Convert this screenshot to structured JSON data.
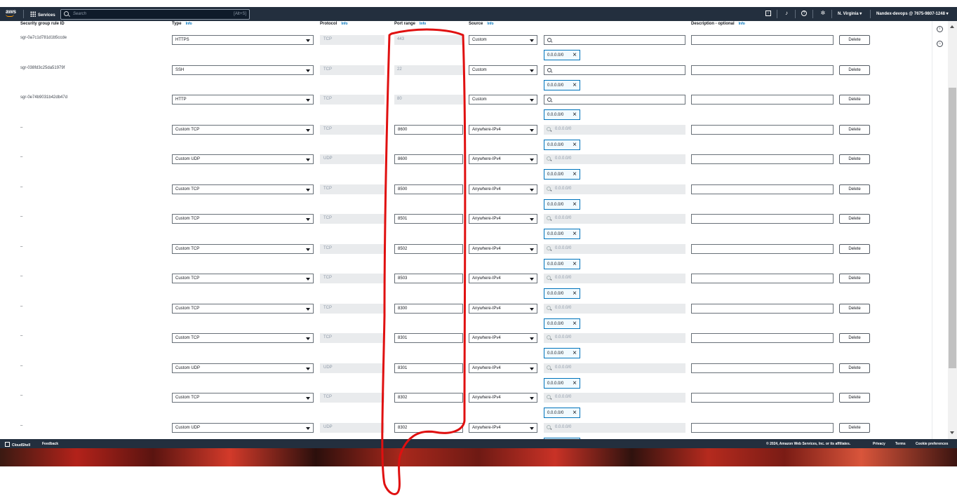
{
  "topbar": {
    "logo": "aws",
    "services": "Services",
    "search_placeholder": "Search",
    "shortcut": "[Alt+S]",
    "region": "N. Virginia",
    "account": "Nandex-devops @ 7675-9807-1248"
  },
  "columns": {
    "rule_id": "Security group rule ID",
    "type": "Type",
    "protocol": "Protocol",
    "port_range": "Port range",
    "source": "Source",
    "description": "Description - optional",
    "info": "Info"
  },
  "rows": [
    {
      "id": "sgr-0a7c1d781d1b5ccde",
      "type": "HTTPS",
      "protocol": "TCP",
      "port": "443",
      "source": "Custom",
      "cidr_search": "",
      "token": "0.0.0.0/0"
    },
    {
      "id": "sgr-038fd3c25da51979f",
      "type": "SSH",
      "protocol": "TCP",
      "port": "22",
      "source": "Custom",
      "cidr_search": "",
      "token": "0.0.0.0/0"
    },
    {
      "id": "sgr-0e74b9031b42db47d",
      "type": "HTTP",
      "protocol": "TCP",
      "port": "80",
      "source": "Custom",
      "cidr_search": "",
      "token": "0.0.0.0/0"
    },
    {
      "id": "–",
      "type": "Custom TCP",
      "protocol": "TCP",
      "port": "8600",
      "source": "Anywhere-IPv4",
      "cidr_search": "0.0.0.0/0",
      "token": "0.0.0.0/0"
    },
    {
      "id": "–",
      "type": "Custom UDP",
      "protocol": "UDP",
      "port": "8600",
      "source": "Anywhere-IPv4",
      "cidr_search": "0.0.0.0/0",
      "token": "0.0.0.0/0"
    },
    {
      "id": "–",
      "type": "Custom TCP",
      "protocol": "TCP",
      "port": "8500",
      "source": "Anywhere-IPv4",
      "cidr_search": "0.0.0.0/0",
      "token": "0.0.0.0/0"
    },
    {
      "id": "–",
      "type": "Custom TCP",
      "protocol": "TCP",
      "port": "8501",
      "source": "Anywhere-IPv4",
      "cidr_search": "0.0.0.0/0",
      "token": "0.0.0.0/0"
    },
    {
      "id": "–",
      "type": "Custom TCP",
      "protocol": "TCP",
      "port": "8502",
      "source": "Anywhere-IPv4",
      "cidr_search": "0.0.0.0/0",
      "token": "0.0.0.0/0"
    },
    {
      "id": "–",
      "type": "Custom TCP",
      "protocol": "TCP",
      "port": "8503",
      "source": "Anywhere-IPv4",
      "cidr_search": "0.0.0.0/0",
      "token": "0.0.0.0/0"
    },
    {
      "id": "–",
      "type": "Custom TCP",
      "protocol": "TCP",
      "port": "8300",
      "source": "Anywhere-IPv4",
      "cidr_search": "0.0.0.0/0",
      "token": "0.0.0.0/0"
    },
    {
      "id": "–",
      "type": "Custom TCP",
      "protocol": "TCP",
      "port": "8301",
      "source": "Anywhere-IPv4",
      "cidr_search": "0.0.0.0/0",
      "token": "0.0.0.0/0"
    },
    {
      "id": "–",
      "type": "Custom UDP",
      "protocol": "UDP",
      "port": "8301",
      "source": "Anywhere-IPv4",
      "cidr_search": "0.0.0.0/0",
      "token": "0.0.0.0/0"
    },
    {
      "id": "–",
      "type": "Custom TCP",
      "protocol": "TCP",
      "port": "8302",
      "source": "Anywhere-IPv4",
      "cidr_search": "0.0.0.0/0",
      "token": "0.0.0.0/0"
    },
    {
      "id": "–",
      "type": "Custom UDP",
      "protocol": "UDP",
      "port": "8302",
      "source": "Anywhere-IPv4",
      "cidr_search": "0.0.0.0/0",
      "token": ""
    }
  ],
  "delete_label": "Delete",
  "footer": {
    "cloudshell": "CloudShell",
    "feedback": "Feedback",
    "copyright": "© 2024, Amazon Web Services, Inc. or its affiliates.",
    "privacy": "Privacy",
    "terms": "Terms",
    "cookies": "Cookie preferences"
  },
  "colors": {
    "nav_bg": "#232f3e",
    "link": "#0073bb",
    "annotation": "#e01010"
  }
}
